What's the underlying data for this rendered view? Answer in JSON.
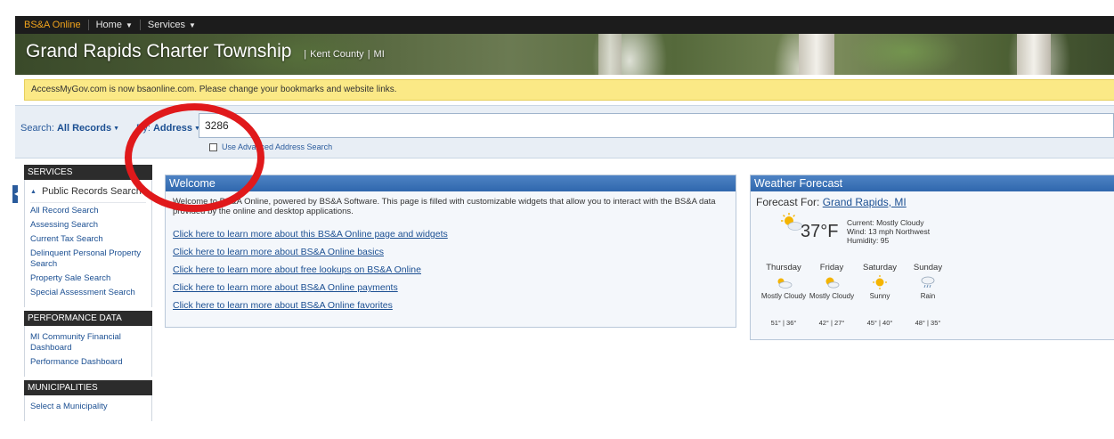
{
  "nav": {
    "brand": "BS&A Online",
    "home_label": "Home",
    "services_label": "Services"
  },
  "banner": {
    "title": "Grand Rapids Charter Township",
    "county": "Kent County",
    "state": "MI"
  },
  "notice": {
    "text": "AccessMyGov.com is now bsaonline.com. Please change your bookmarks and website links."
  },
  "search": {
    "search_label": "Search:",
    "search_value": "All Records",
    "by_label": "By:",
    "by_value": "Address",
    "input_value": "3286",
    "advanced_label": "Use Advanced Address Search"
  },
  "sidebar": {
    "services_header": "SERVICES",
    "public_records_label": "Public Records Search",
    "services_links": [
      "All Record Search",
      "Assessing Search",
      "Current Tax Search",
      "Delinquent Personal Property Search",
      "Property Sale Search",
      "Special Assessment Search"
    ],
    "performance_header": "PERFORMANCE DATA",
    "performance_links": [
      "MI Community Financial Dashboard",
      "Performance Dashboard"
    ],
    "municipalities_header": "MUNICIPALITIES",
    "municipalities_links": [
      "Select a Municipality"
    ]
  },
  "welcome": {
    "title": "Welcome",
    "intro": "Welcome to BS&A Online, powered by BS&A Software. This page is filled with customizable widgets that allow you to interact with the BS&A data provided by the online and desktop applications.",
    "links": [
      "Click here to learn more about this BS&A Online page and widgets",
      "Click here to learn more about BS&A Online basics",
      "Click here to learn more about free lookups on BS&A Online",
      "Click here to learn more about BS&A Online payments",
      "Click here to learn more about BS&A Online favorites"
    ]
  },
  "weather": {
    "title": "Weather Forecast",
    "forecast_for_label": "Forecast For:",
    "location": "Grand Rapids, MI",
    "temp": "37°F",
    "current": "Current: Mostly Cloudy",
    "wind": "Wind: 13 mph Northwest",
    "humidity": "Humidity: 95",
    "days": [
      {
        "name": "Thursday",
        "cond": "Mostly Cloudy",
        "hilo": "51° | 36°",
        "icon": "partly-cloudy-icon"
      },
      {
        "name": "Friday",
        "cond": "Mostly Cloudy",
        "hilo": "42° | 27°",
        "icon": "partly-cloudy-icon"
      },
      {
        "name": "Saturday",
        "cond": "Sunny",
        "hilo": "45° | 40°",
        "icon": "sun-icon"
      },
      {
        "name": "Sunday",
        "cond": "Rain",
        "hilo": "48° | 35°",
        "icon": "rain-icon"
      }
    ]
  },
  "colors": {
    "annotation_circle": "#e0191b",
    "brand_orange": "#f0a31c",
    "link_blue": "#1b4f92",
    "panel_header": "#2f67ad",
    "notice_yellow": "#fbe986"
  }
}
